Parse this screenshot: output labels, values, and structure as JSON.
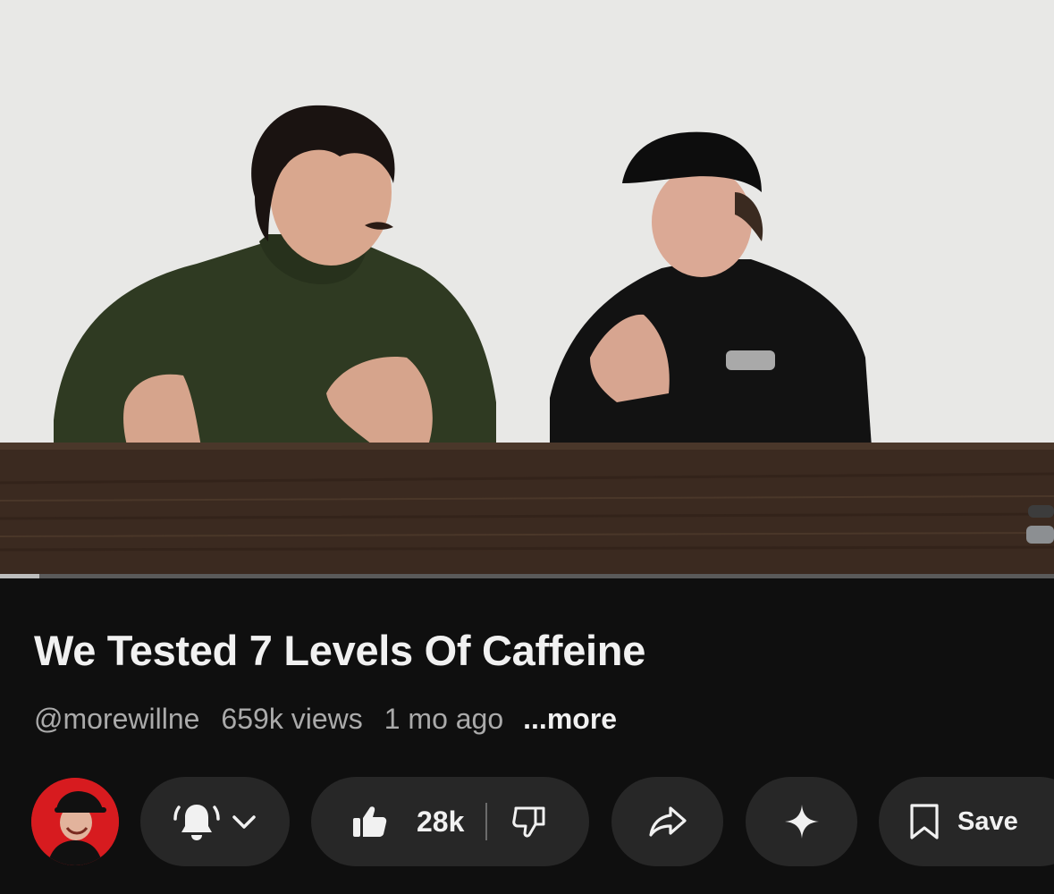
{
  "video": {
    "title": "We Tested 7 Levels Of Caffeine",
    "progress_fraction": 0.037
  },
  "meta": {
    "channel_handle": "@morewillne",
    "views": "659k views",
    "age": "1 mo ago",
    "more_label": "...more"
  },
  "actions": {
    "bell_icon": "bell-icon",
    "chevron_icon": "chevron-down-icon",
    "like_icon": "thumbs-up-icon",
    "like_count": "28k",
    "dislike_icon": "thumbs-down-icon",
    "share_icon": "share-icon",
    "ai_icon": "sparkle-icon",
    "save_icon": "bookmark-icon",
    "save_label": "Save"
  },
  "colors": {
    "background": "#0f0f0f",
    "pill": "#272727",
    "text_primary": "#f1f1f1",
    "text_secondary": "#aaaaaa",
    "avatar_bg": "#d71b1f"
  }
}
